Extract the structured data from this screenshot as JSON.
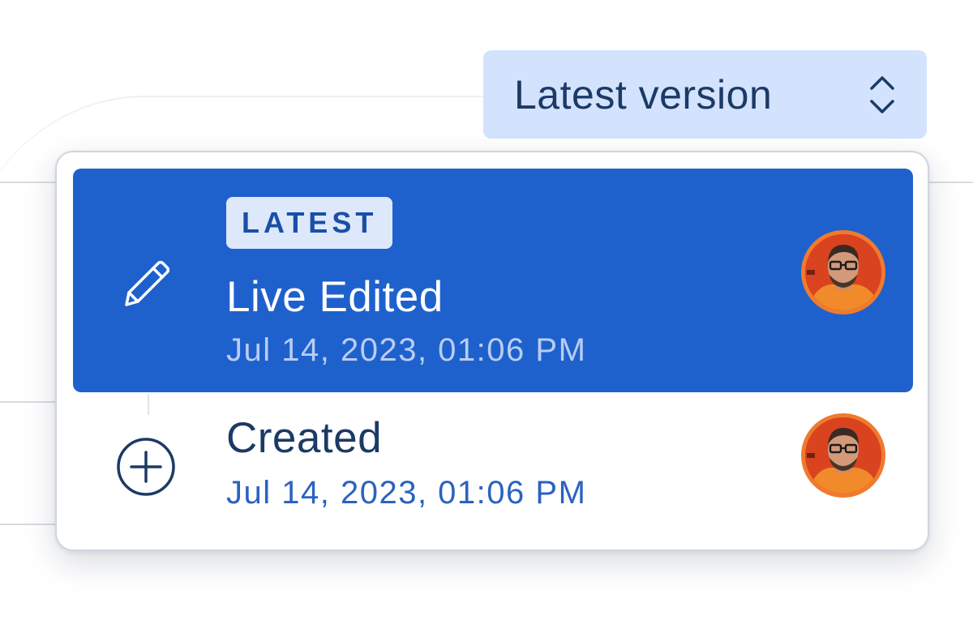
{
  "version_selector": {
    "label": "Latest version",
    "icon": "chevron-up-down-icon"
  },
  "versions": [
    {
      "badge": "LATEST",
      "title": "Live Edited",
      "timestamp": "Jul 14, 2023, 01:06 PM",
      "icon": "pencil-icon",
      "selected": true,
      "avatar": "user-avatar"
    },
    {
      "title": "Created",
      "timestamp": "Jul 14, 2023, 01:06 PM",
      "icon": "plus-circle-icon",
      "selected": false,
      "avatar": "user-avatar"
    }
  ],
  "colors": {
    "accent": "#1e61cd",
    "selector_bg": "#d3e3fd",
    "text_dark": "#1c3a66",
    "timestamp_blue": "#2b62c0",
    "avatar_ring": "#f07a2e"
  }
}
